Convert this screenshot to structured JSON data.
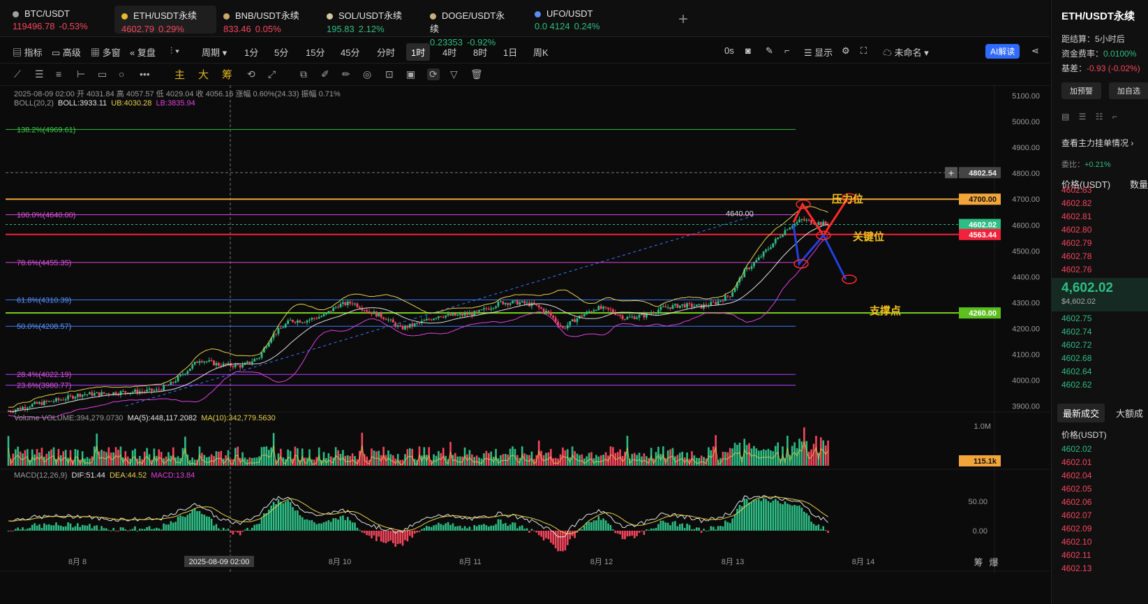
{
  "tabs": [
    {
      "symbol": "BTC/USDT",
      "price": "119496.78",
      "change": "-0.53%",
      "dir": "down",
      "dot": "#9aa0a6"
    },
    {
      "symbol": "ETH/USDT永续",
      "price": "4602.79",
      "change": "0.29%",
      "dir": "down",
      "dot": "#e8b92d"
    },
    {
      "symbol": "BNB/USDT永续",
      "price": "833.46",
      "change": "0.05%",
      "dir": "down",
      "dot": "#c8a96a"
    },
    {
      "symbol": "SOL/USDT永续",
      "price": "195.83",
      "change": "2.12%",
      "dir": "up",
      "dot": "#d1c8a0"
    },
    {
      "symbol": "DOGE/USDT永续",
      "price": "0.23353",
      "change": "-0.92%",
      "dir": "up",
      "dot": "#c8b07a"
    },
    {
      "symbol": "UFO/USDT",
      "price": "0.0 4124",
      "change": "0.24%",
      "dir": "up",
      "dot": "#5b8def"
    }
  ],
  "toolbar": {
    "indicators": "指标",
    "advanced": "高级",
    "multi": "多窗",
    "replay": "复盘",
    "period": "周期",
    "intervals": [
      "1分",
      "5分",
      "15分",
      "45分",
      "分时",
      "1时",
      "4时",
      "8时",
      "1日",
      "周K"
    ],
    "active_interval": "1时",
    "seconds": "0s",
    "display": "显示",
    "unnamed": "未命名",
    "ai": "AI解读"
  },
  "draw_tools": {
    "main": "主",
    "big": "大",
    "chip": "筹"
  },
  "legend": {
    "ohlc": "2025-08-09 02:00  开 4031.84  高 4057.57  低 4029.04  收 4056.16  涨幅 0.60%(24.33)  振幅 0.71%",
    "boll_name": "BOLL(20,2)",
    "boll": "BOLL:3933.11",
    "ub": "UB:4030.28",
    "lb": "LB:3835.94",
    "volume_name": "Volume  VOLUME:394,279.0730",
    "ma5": "MA(5):448,117.2082",
    "ma10": "MA(10):342,779.5630",
    "macd_name": "MACD(12,26,9)",
    "dif": "DIF:51.44",
    "dea": "DEA:44.52",
    "macd": "MACD:13.84"
  },
  "annotations": {
    "resistance": "压力位",
    "key_level": "关键位",
    "support": "支撑点",
    "high_marker": "4640.00"
  },
  "price_tags": {
    "crosshair": "4802.54",
    "resistance": "4700.00",
    "last": "4602.02",
    "key": "4563.44",
    "support": "4260.00",
    "volume_last": "115.1k"
  },
  "x_axis": {
    "labels": [
      "8月 8",
      "8月 10",
      "8月 11",
      "8月 12",
      "8月 13",
      "8月 14"
    ],
    "crosshair": "2025-08-09 02:00"
  },
  "bottom_right": {
    "a": "筹",
    "b": "爆"
  },
  "sidebar": {
    "title": "ETH/USDT永续",
    "countdown_label": "距结算：",
    "countdown": "5小时后",
    "funding_label": "资金费率：",
    "funding": "0.0100%",
    "basis_label": "基差：",
    "basis": "-0.93 (-0.02%)",
    "alert_btn": "加预警",
    "watch_btn": "加自选",
    "depth_link": "查看主力挂单情况",
    "ratio_label": "委比：",
    "ratio": "+0.21%",
    "price_header": "价格(USDT)",
    "qty_header": "数量",
    "asks": [
      "4602.83",
      "4602.82",
      "4602.81",
      "4602.80",
      "4602.79",
      "4602.78",
      "4602.76"
    ],
    "mid_price": "4,602.02",
    "mid_sub": "$4,602.02",
    "bids": [
      "4602.75",
      "4602.74",
      "4602.72",
      "4602.68",
      "4602.64",
      "4602.62"
    ],
    "trades_tab": "最新成交",
    "big_tab": "大额成",
    "trades_header": "价格(USDT)",
    "trades": [
      {
        "p": "4602.02",
        "d": "up"
      },
      {
        "p": "4602.01",
        "d": "down"
      },
      {
        "p": "4602.04",
        "d": "down"
      },
      {
        "p": "4602.05",
        "d": "down"
      },
      {
        "p": "4602.06",
        "d": "down"
      },
      {
        "p": "4602.07",
        "d": "down"
      },
      {
        "p": "4602.09",
        "d": "down"
      },
      {
        "p": "4602.10",
        "d": "down"
      },
      {
        "p": "4602.11",
        "d": "down"
      },
      {
        "p": "4602.13",
        "d": "down"
      }
    ]
  },
  "chart_data": {
    "type": "candlestick",
    "price_axis": {
      "range": [
        3850,
        5130
      ],
      "ticks": [
        5100,
        5000,
        4900,
        4800,
        4700,
        4600,
        4500,
        4400,
        4300,
        4200,
        4100,
        4000,
        3900
      ]
    },
    "fib_levels": [
      {
        "label": "138.2%(4969.61)",
        "value": 4969.61,
        "color": "#2ebd3a"
      },
      {
        "label": "100.0%(4640.00)",
        "value": 4640.0,
        "color": "#e040e0"
      },
      {
        "label": "78.6%(4455.35)",
        "value": 4455.35,
        "color": "#e040e0"
      },
      {
        "label": "61.8%(4310.39)",
        "value": 4310.39,
        "color": "#3b7bff"
      },
      {
        "label": "50.0%(4208.57)",
        "value": 4208.57,
        "color": "#3b7bff"
      },
      {
        "label": "28.4%(4022.19)",
        "value": 4022.19,
        "color": "#b040ff"
      },
      {
        "label": "23.6%(3980.77)",
        "value": 3980.77,
        "color": "#b040ff"
      }
    ],
    "levels": {
      "resistance": 4700,
      "key": 4563.44,
      "support": 4260,
      "last": 4602.02
    },
    "close_anchors": [
      [
        0,
        3880
      ],
      [
        10,
        3905
      ],
      [
        22,
        3925
      ],
      [
        30,
        3945
      ],
      [
        40,
        3948
      ],
      [
        50,
        3955
      ],
      [
        62,
        3960
      ],
      [
        68,
        3985
      ],
      [
        75,
        4040
      ],
      [
        80,
        4080
      ],
      [
        88,
        4060
      ],
      [
        98,
        4055
      ],
      [
        105,
        4090
      ],
      [
        110,
        4170
      ],
      [
        118,
        4230
      ],
      [
        124,
        4230
      ],
      [
        132,
        4250
      ],
      [
        138,
        4290
      ],
      [
        144,
        4300
      ],
      [
        150,
        4270
      ],
      [
        158,
        4240
      ],
      [
        164,
        4200
      ],
      [
        172,
        4220
      ],
      [
        180,
        4250
      ],
      [
        188,
        4250
      ],
      [
        196,
        4260
      ],
      [
        206,
        4300
      ],
      [
        214,
        4300
      ],
      [
        220,
        4290
      ],
      [
        226,
        4260
      ],
      [
        232,
        4200
      ],
      [
        238,
        4240
      ],
      [
        246,
        4280
      ],
      [
        252,
        4270
      ],
      [
        258,
        4240
      ],
      [
        266,
        4250
      ],
      [
        274,
        4280
      ],
      [
        282,
        4290
      ],
      [
        290,
        4285
      ],
      [
        296,
        4300
      ],
      [
        302,
        4330
      ],
      [
        308,
        4420
      ],
      [
        314,
        4470
      ],
      [
        320,
        4530
      ],
      [
        326,
        4590
      ],
      [
        332,
        4620
      ],
      [
        338,
        4610
      ],
      [
        344,
        4600
      ]
    ],
    "volume_axis": {
      "labels": [
        "1.0M"
      ]
    },
    "macd_axis": {
      "labels": [
        "50.00",
        "0.00"
      ]
    }
  }
}
